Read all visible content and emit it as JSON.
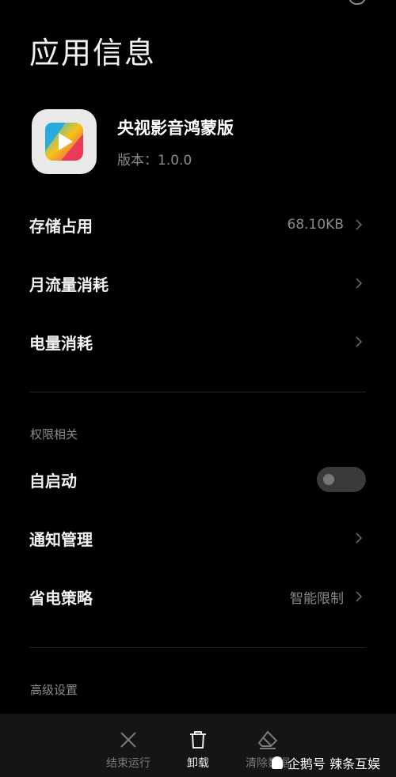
{
  "page_title": "应用信息",
  "app": {
    "name": "央视影音鸿蒙版",
    "version": "版本：1.0.0"
  },
  "rows_top": [
    {
      "label": "存储占用",
      "value": "68.10KB"
    },
    {
      "label": "月流量消耗",
      "value": ""
    },
    {
      "label": "电量消耗",
      "value": ""
    }
  ],
  "permissions": {
    "header": "权限相关",
    "autostart_label": "自启动",
    "autostart_on": false,
    "notification_label": "通知管理",
    "power_label": "省电策略",
    "power_value": "智能限制"
  },
  "advanced_header": "高级设置",
  "bottom_bar": {
    "stop": "结束运行",
    "uninstall": "卸载",
    "clear": "清除数据"
  },
  "watermark": "企鹅号 辣条互娱",
  "colors": {
    "background": "#000000",
    "text_primary": "#f2f2f2",
    "text_secondary": "#8a8a8a",
    "toggle_off": "#3a3a3a"
  }
}
